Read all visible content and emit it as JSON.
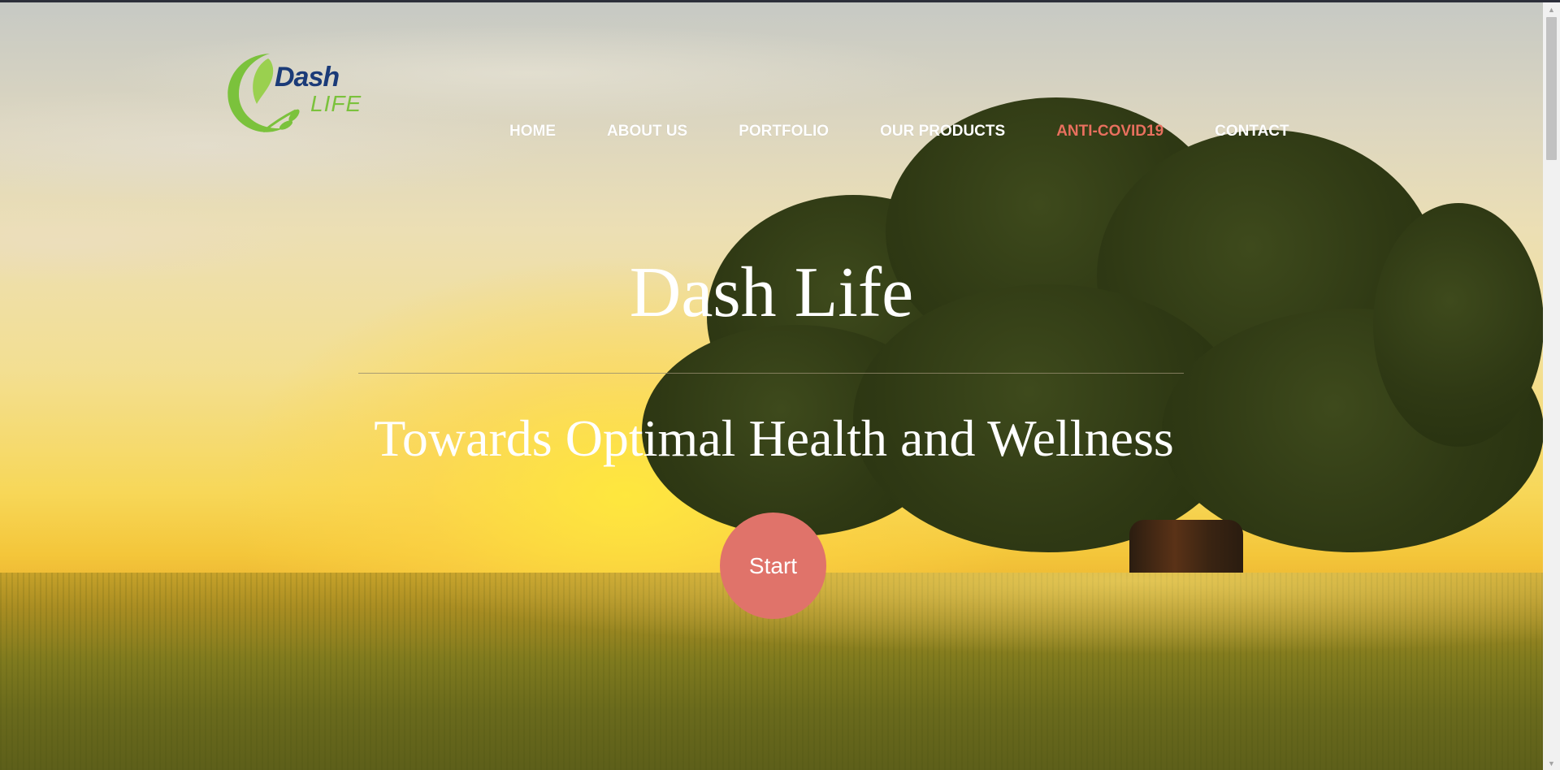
{
  "logo": {
    "word1": "Dash",
    "word2": "LIFE"
  },
  "nav": [
    {
      "label": "HOME",
      "active": false
    },
    {
      "label": "ABOUT US",
      "active": false
    },
    {
      "label": "PORTFOLIO",
      "active": false
    },
    {
      "label": "OUR PRODUCTS",
      "active": false
    },
    {
      "label": "ANTI-COVID19",
      "active": true
    },
    {
      "label": "CONTACT",
      "active": false
    }
  ],
  "hero": {
    "title": "Dash Life",
    "subtitle": "Towards Optimal Health and Wellness",
    "start_label": "Start"
  },
  "colors": {
    "accent": "#e0736a",
    "active_nav": "#e8705e",
    "logo_blue": "#1b3b78",
    "logo_green": "#7bc23c"
  },
  "scrollbar": {
    "up_icon": "▲",
    "down_icon": "▼"
  }
}
